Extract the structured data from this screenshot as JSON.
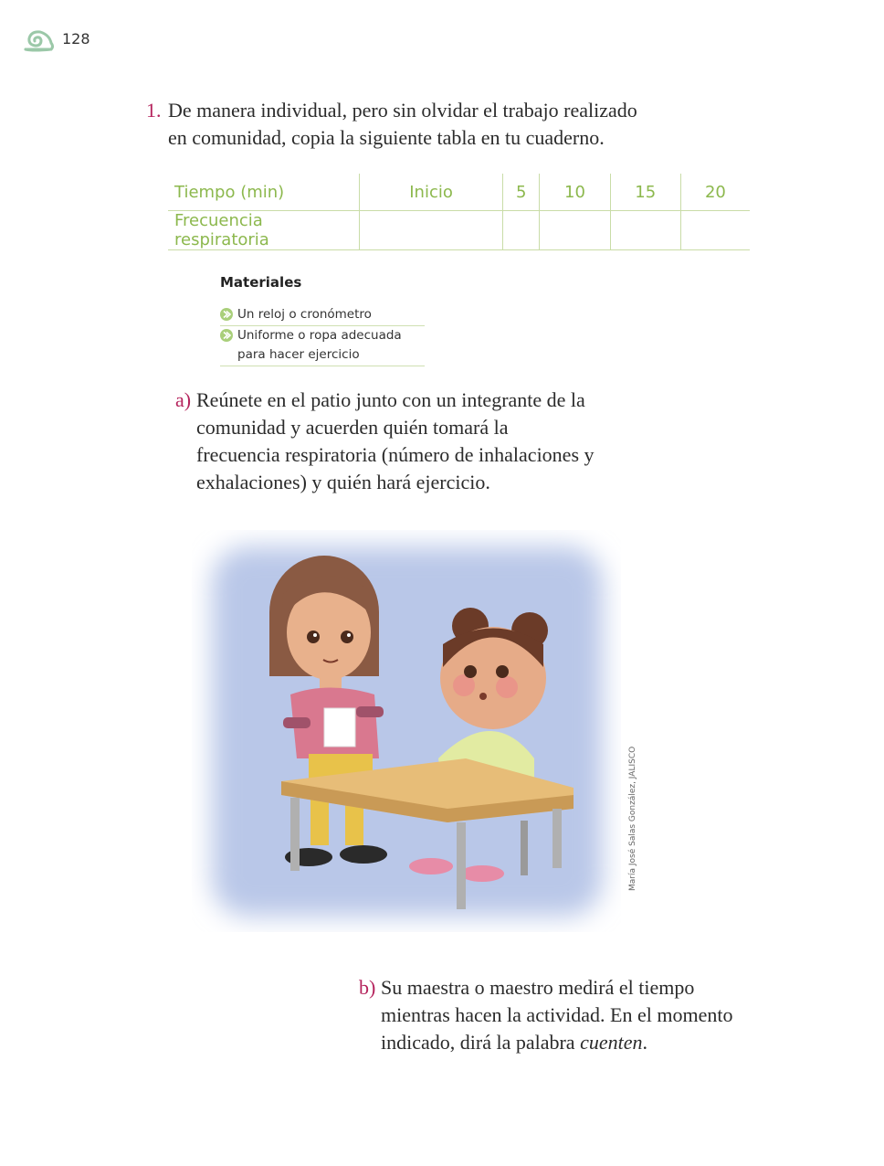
{
  "header": {
    "page_number": "128",
    "logo_icon": "snail-icon"
  },
  "instruction_1": {
    "marker": "1.",
    "text": "De manera individual, pero sin olvidar el trabajo realizado en comunidad, copia la siguiente tabla en tu cuaderno."
  },
  "table": {
    "row_labels": [
      "Tiempo (min)",
      "Frecuencia respiratoria"
    ],
    "columns": [
      "Inicio",
      "5",
      "10",
      "15",
      "20"
    ]
  },
  "materials": {
    "title": "Materiales",
    "items": [
      "Un reloj o cronómetro",
      "Uniforme o ropa adecuada para hacer ejercicio"
    ]
  },
  "item_a": {
    "marker": "a)",
    "text": "Reúnete en el patio junto con un integrante de la comunidad y acuerden quién tomará la frecuencia respiratoria (número de inhalaciones y exhalaciones) y quién hará ejercicio."
  },
  "illustration": {
    "credit": "María José Salas González, JALISCO"
  },
  "item_b": {
    "marker": "b)",
    "text_before": "Su maestra o maestro medirá el tiempo mientras hacen la actividad. En el momento indicado, dirá la palabra ",
    "emphasis": "cuenten",
    "text_after": "."
  },
  "colors": {
    "accent_green": "#8cb84d",
    "marker_pink": "#b5245d"
  }
}
